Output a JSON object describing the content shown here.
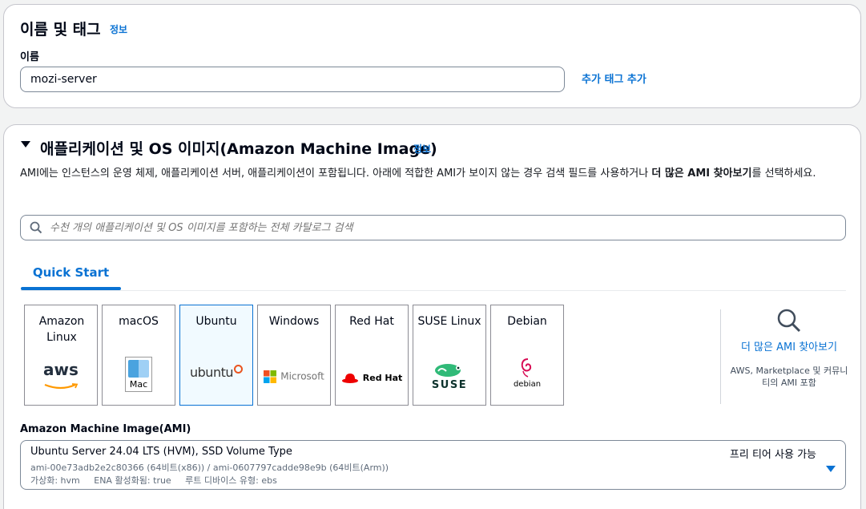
{
  "name_tags": {
    "title": "이름 및 태그",
    "info": "정보",
    "name_label": "이름",
    "name_value": "mozi-server",
    "add_tag": "추가 태그 추가"
  },
  "ami_section": {
    "title": "애플리케이션 및 OS 이미지(Amazon Machine Image)",
    "info": "정보",
    "description_pre": "AMI에는 인스턴스의 운영 체제, 애플리케이션 서버, 애플리케이션이 포함됩니다. 아래에 적합한 AMI가 보이지 않는 경우 검색 필드를 사용하거나 ",
    "description_bold": "더 많은 AMI 찾아보기",
    "description_post": "를 선택하세요.",
    "search_placeholder": "수천 개의 애플리케이션 및 OS 이미지를 포함하는 전체 카탈로그 검색",
    "tab_quick_start": "Quick Start",
    "tiles": [
      {
        "name": "Amazon Linux",
        "logo": "aws"
      },
      {
        "name": "macOS",
        "logo": "Mac"
      },
      {
        "name": "Ubuntu",
        "logo": "ubuntu"
      },
      {
        "name": "Windows",
        "logo": "Microsoft"
      },
      {
        "name": "Red Hat",
        "logo": "Red Hat"
      },
      {
        "name": "SUSE Linux",
        "logo": "SUSE"
      },
      {
        "name": "Debian",
        "logo": "debian"
      }
    ],
    "browse_more": "더 많은 AMI 찾아보기",
    "browse_more_sub": "AWS, Marketplace 및 커뮤니티의 AMI 포함",
    "ami_label": "Amazon Machine Image(AMI)",
    "selected_ami": {
      "name": "Ubuntu Server 24.04 LTS (HVM), SSD Volume Type",
      "free_tier": "프리 티어 사용 가능",
      "ids": "ami-00e73adb2e2c80366 (64비트(x86)) / ami-0607797cadde98e9b (64비트(Arm))",
      "meta": "가상화: hvm     ENA 활성화됨: true     루트 디바이스 유형: ebs"
    }
  },
  "colors": {
    "accent": "#0972d3",
    "ubuntu_orange": "#e95420",
    "redhat_red": "#ee0000",
    "suse_green": "#30ba78",
    "debian_red": "#d70a53",
    "aws_orange": "#ff9900"
  }
}
